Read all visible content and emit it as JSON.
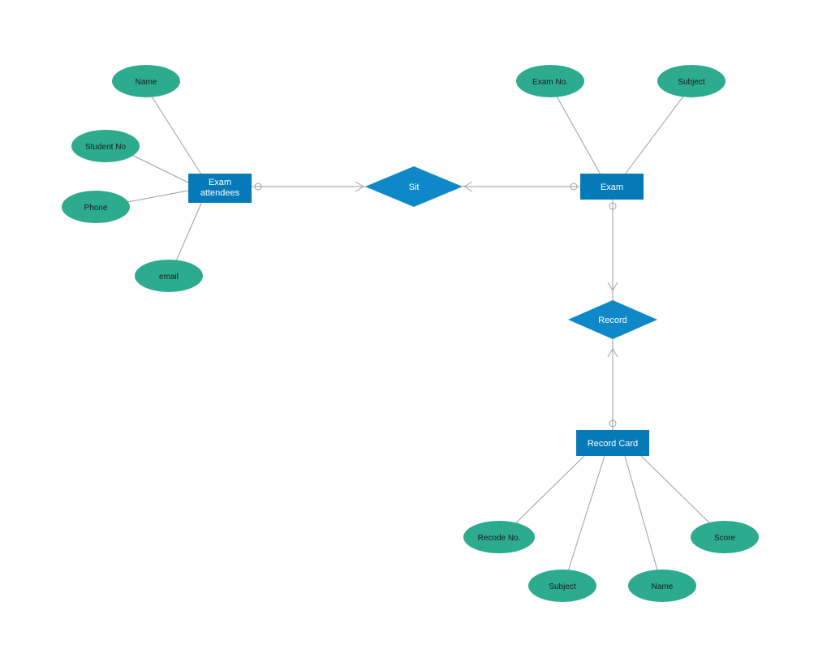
{
  "entities": {
    "examAttendees": "Exam attendees",
    "exam": "Exam",
    "recordCard": "Record Card"
  },
  "relationships": {
    "sit": "Sit",
    "record": "Record"
  },
  "attributes": {
    "name": "Name",
    "studentNo": "Student No",
    "phone": "Phone",
    "email": "email",
    "examNo": "Exam No.",
    "subject": "Subject",
    "recodeNo": "Recode No.",
    "subject2": "Subject",
    "name2": "Name",
    "score": "Score"
  },
  "colors": {
    "entity": "#0679b8",
    "attribute": "#2dab8e",
    "relationship": "#0f88c9",
    "connector": "#9e9e9e"
  }
}
